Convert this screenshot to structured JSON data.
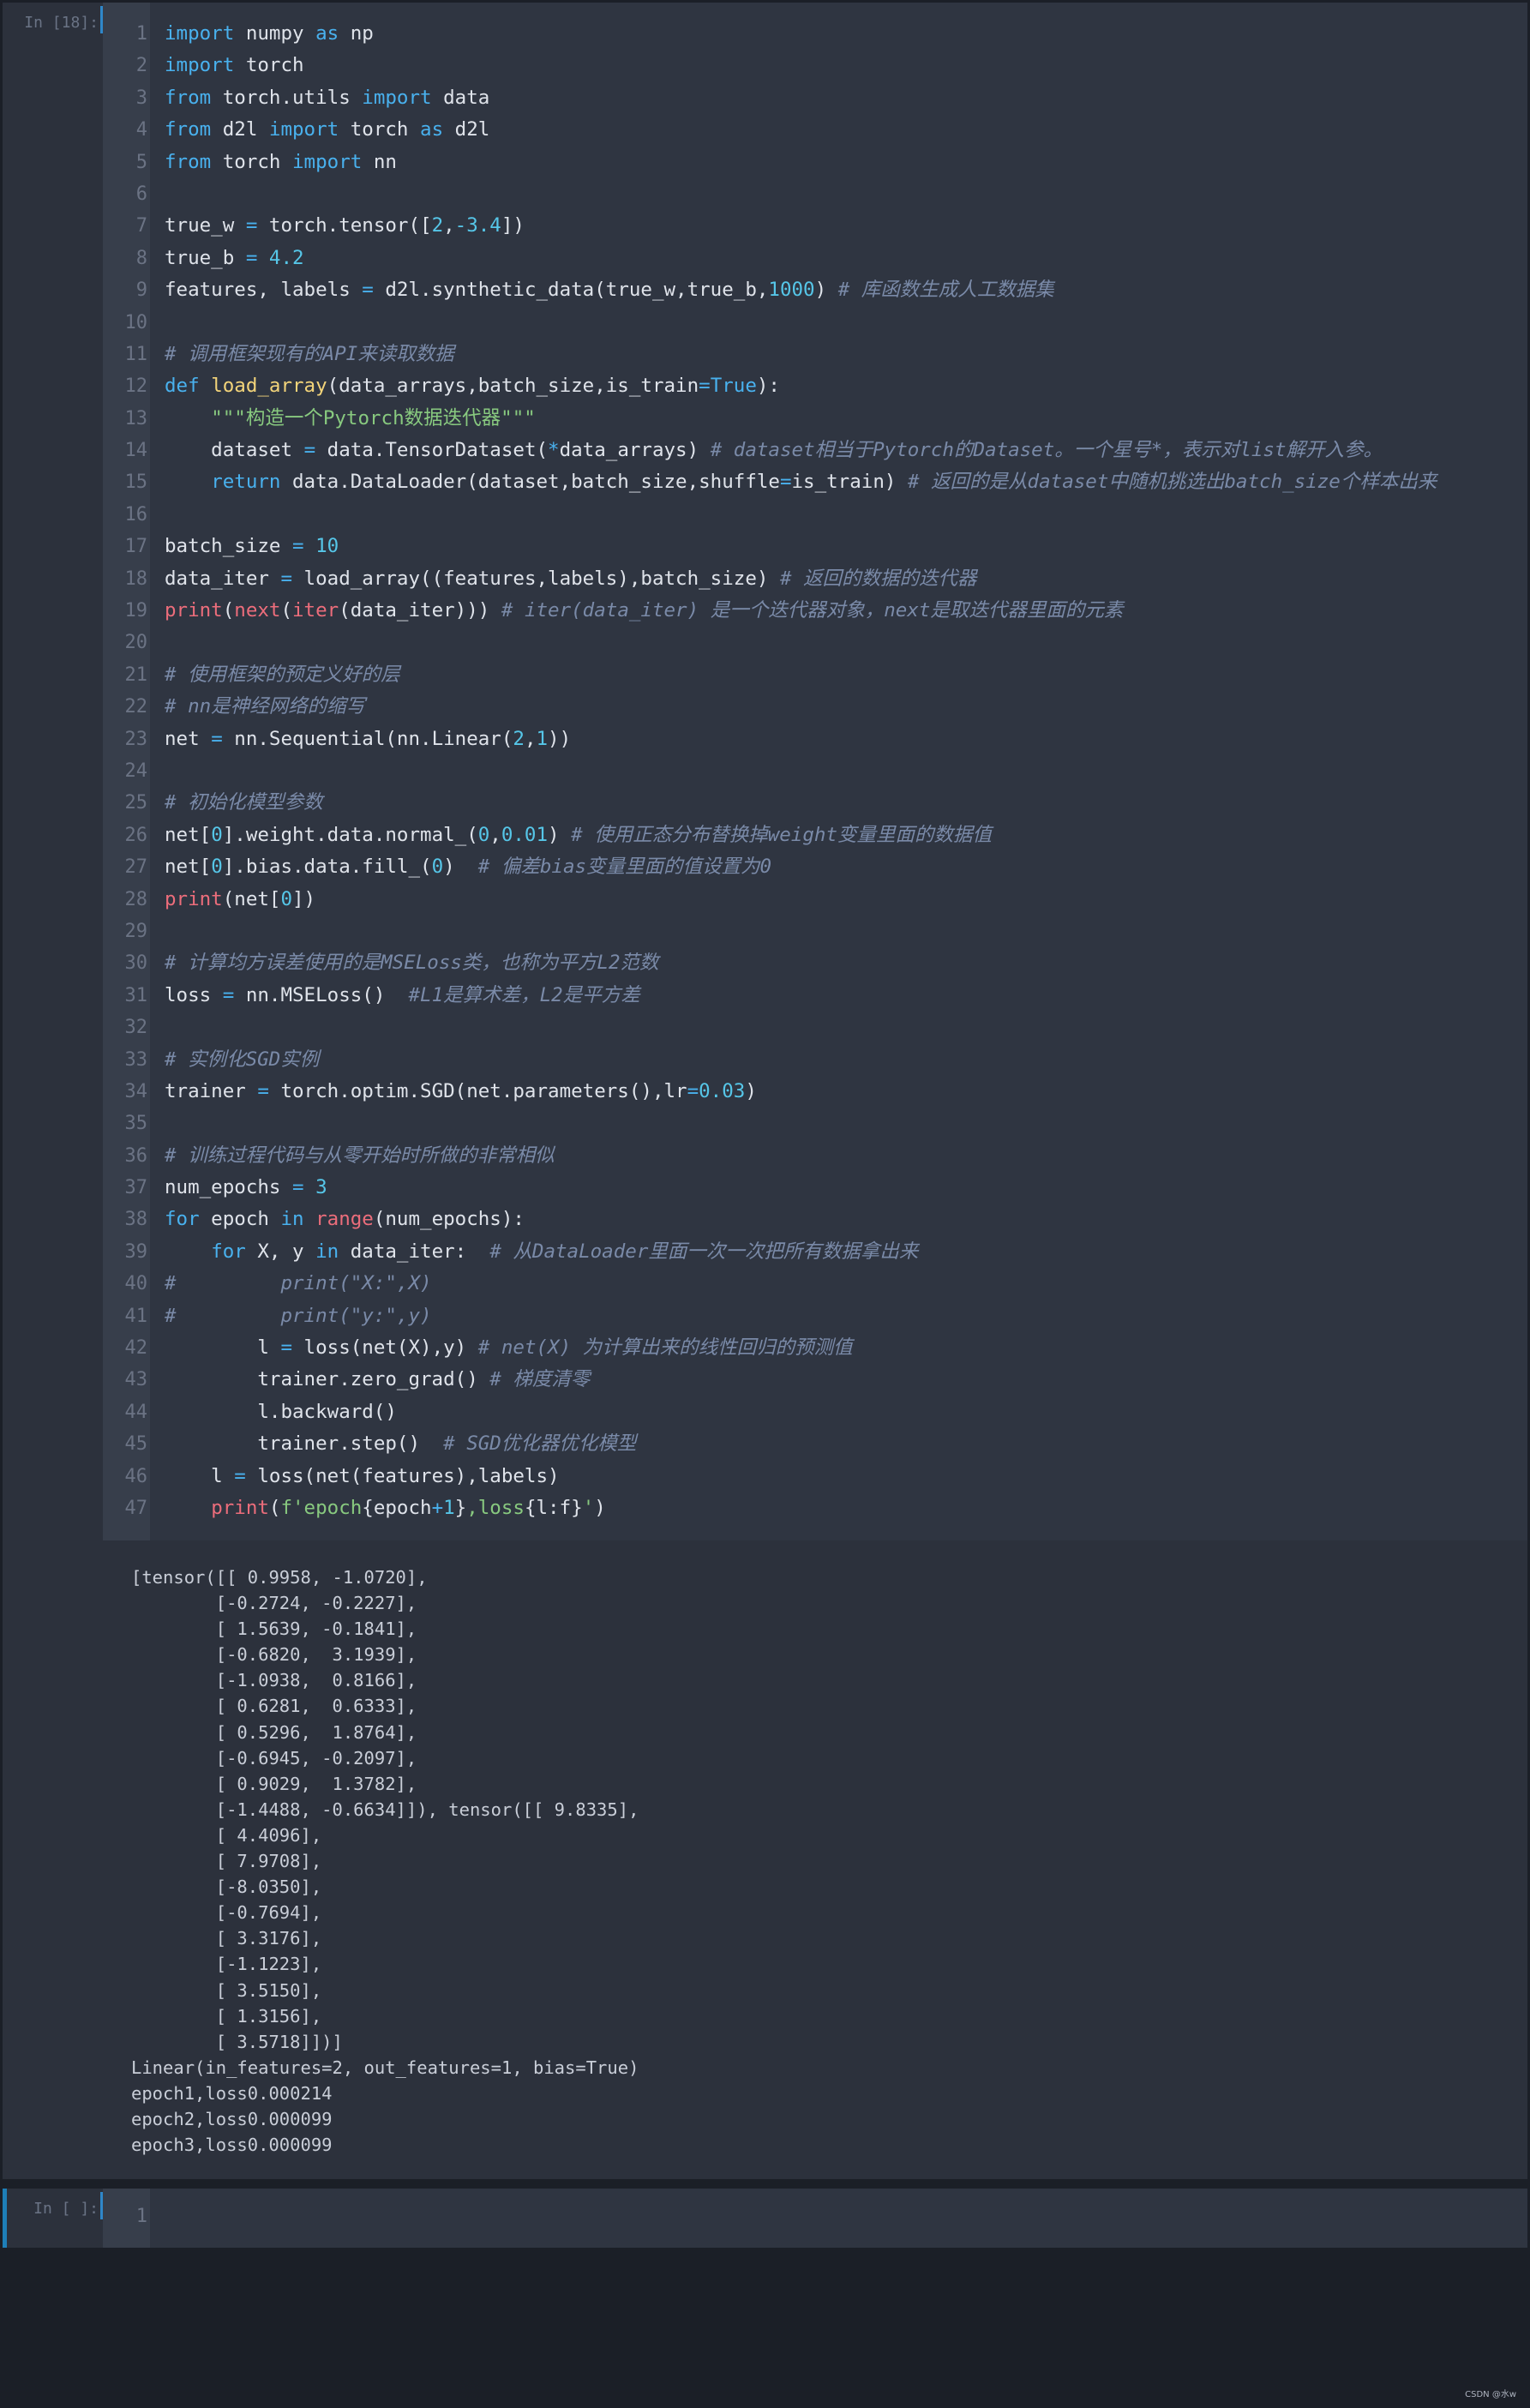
{
  "notebook": {
    "cells": [
      {
        "prompt": "In [18]:",
        "code_lines": [
          [
            [
              "kw",
              "import"
            ],
            [
              "txt",
              " numpy "
            ],
            [
              "kw",
              "as"
            ],
            [
              "txt",
              " np"
            ]
          ],
          [
            [
              "kw",
              "import"
            ],
            [
              "txt",
              " torch"
            ]
          ],
          [
            [
              "kw",
              "from"
            ],
            [
              "txt",
              " torch.utils "
            ],
            [
              "kw",
              "import"
            ],
            [
              "txt",
              " data"
            ]
          ],
          [
            [
              "kw",
              "from"
            ],
            [
              "txt",
              " d2l "
            ],
            [
              "kw",
              "import"
            ],
            [
              "txt",
              " torch "
            ],
            [
              "kw",
              "as"
            ],
            [
              "txt",
              " d2l"
            ]
          ],
          [
            [
              "kw",
              "from"
            ],
            [
              "txt",
              " torch "
            ],
            [
              "kw",
              "import"
            ],
            [
              "txt",
              " nn"
            ]
          ],
          [],
          [
            [
              "txt",
              "true_w "
            ],
            [
              "op",
              "="
            ],
            [
              "txt",
              " torch.tensor(["
            ],
            [
              "num",
              "2"
            ],
            [
              "txt",
              ","
            ],
            [
              "num",
              "-3.4"
            ],
            [
              "txt",
              "])"
            ]
          ],
          [
            [
              "txt",
              "true_b "
            ],
            [
              "op",
              "="
            ],
            [
              "txt",
              " "
            ],
            [
              "num",
              "4.2"
            ]
          ],
          [
            [
              "txt",
              "features, labels "
            ],
            [
              "op",
              "="
            ],
            [
              "txt",
              " d2l.synthetic_data(true_w,true_b,"
            ],
            [
              "num",
              "1000"
            ],
            [
              "txt",
              ") "
            ],
            [
              "com",
              "# 库函数生成人工数据集"
            ]
          ],
          [],
          [
            [
              "com",
              "# 调用框架现有的API来读取数据"
            ]
          ],
          [
            [
              "def",
              "def"
            ],
            [
              "txt",
              " "
            ],
            [
              "fn",
              "load_array"
            ],
            [
              "txt",
              "(data_arrays,batch_size,is_train"
            ],
            [
              "op",
              "="
            ],
            [
              "kw",
              "True"
            ],
            [
              "txt",
              "):"
            ]
          ],
          [
            [
              "txt",
              "    "
            ],
            [
              "str",
              "\"\"\"构造一个Pytorch数据迭代器\"\"\""
            ]
          ],
          [
            [
              "txt",
              "    dataset "
            ],
            [
              "op",
              "="
            ],
            [
              "txt",
              " data.TensorDataset("
            ],
            [
              "op",
              "*"
            ],
            [
              "txt",
              "data_arrays) "
            ],
            [
              "com",
              "# dataset相当于Pytorch的Dataset。一个星号*，表示对list解开入参。"
            ]
          ],
          [
            [
              "txt",
              "    "
            ],
            [
              "kw",
              "return"
            ],
            [
              "txt",
              " data.DataLoader(dataset,batch_size,shuffle"
            ],
            [
              "op",
              "="
            ],
            [
              "txt",
              "is_train) "
            ],
            [
              "com",
              "# 返回的是从dataset中随机挑选出batch_size个样本出来"
            ]
          ],
          [],
          [
            [
              "txt",
              "batch_size "
            ],
            [
              "op",
              "="
            ],
            [
              "txt",
              " "
            ],
            [
              "num",
              "10"
            ]
          ],
          [
            [
              "txt",
              "data_iter "
            ],
            [
              "op",
              "="
            ],
            [
              "txt",
              " load_array((features,labels),batch_size) "
            ],
            [
              "com",
              "# 返回的数据的迭代器"
            ]
          ],
          [
            [
              "bi",
              "print"
            ],
            [
              "txt",
              "("
            ],
            [
              "bi",
              "next"
            ],
            [
              "txt",
              "("
            ],
            [
              "bi",
              "iter"
            ],
            [
              "txt",
              "(data_iter))) "
            ],
            [
              "com",
              "# iter(data_iter) 是一个迭代器对象，next是取迭代器里面的元素"
            ]
          ],
          [],
          [
            [
              "com",
              "# 使用框架的预定义好的层"
            ]
          ],
          [
            [
              "com",
              "# nn是神经网络的缩写"
            ]
          ],
          [
            [
              "txt",
              "net "
            ],
            [
              "op",
              "="
            ],
            [
              "txt",
              " nn.Sequential(nn.Linear("
            ],
            [
              "num",
              "2"
            ],
            [
              "txt",
              ","
            ],
            [
              "num",
              "1"
            ],
            [
              "txt",
              "))"
            ]
          ],
          [],
          [
            [
              "com",
              "# 初始化模型参数"
            ]
          ],
          [
            [
              "txt",
              "net["
            ],
            [
              "num",
              "0"
            ],
            [
              "txt",
              "].weight.data.normal_("
            ],
            [
              "num",
              "0"
            ],
            [
              "txt",
              ","
            ],
            [
              "num",
              "0.01"
            ],
            [
              "txt",
              ") "
            ],
            [
              "com",
              "# 使用正态分布替换掉weight变量里面的数据值"
            ]
          ],
          [
            [
              "txt",
              "net["
            ],
            [
              "num",
              "0"
            ],
            [
              "txt",
              "].bias.data.fill_("
            ],
            [
              "num",
              "0"
            ],
            [
              "txt",
              ")  "
            ],
            [
              "com",
              "# 偏差bias变量里面的值设置为0"
            ]
          ],
          [
            [
              "bi",
              "print"
            ],
            [
              "txt",
              "(net["
            ],
            [
              "num",
              "0"
            ],
            [
              "txt",
              "])"
            ]
          ],
          [],
          [
            [
              "com",
              "# 计算均方误差使用的是MSELoss类，也称为平方L2范数"
            ]
          ],
          [
            [
              "txt",
              "loss "
            ],
            [
              "op",
              "="
            ],
            [
              "txt",
              " nn.MSELoss()  "
            ],
            [
              "com",
              "#L1是算术差，L2是平方差"
            ]
          ],
          [],
          [
            [
              "com",
              "# 实例化SGD实例"
            ]
          ],
          [
            [
              "txt",
              "trainer "
            ],
            [
              "op",
              "="
            ],
            [
              "txt",
              " torch.optim.SGD(net.parameters(),lr"
            ],
            [
              "op",
              "="
            ],
            [
              "num",
              "0.03"
            ],
            [
              "txt",
              ")"
            ]
          ],
          [],
          [
            [
              "com",
              "# 训练过程代码与从零开始时所做的非常相似"
            ]
          ],
          [
            [
              "txt",
              "num_epochs "
            ],
            [
              "op",
              "="
            ],
            [
              "txt",
              " "
            ],
            [
              "num",
              "3"
            ]
          ],
          [
            [
              "kw",
              "for"
            ],
            [
              "txt",
              " epoch "
            ],
            [
              "kw",
              "in"
            ],
            [
              "txt",
              " "
            ],
            [
              "bi",
              "range"
            ],
            [
              "txt",
              "(num_epochs):"
            ]
          ],
          [
            [
              "txt",
              "    "
            ],
            [
              "kw",
              "for"
            ],
            [
              "txt",
              " X, y "
            ],
            [
              "kw",
              "in"
            ],
            [
              "txt",
              " data_iter:  "
            ],
            [
              "com",
              "# 从DataLoader里面一次一次把所有数据拿出来"
            ]
          ],
          [
            [
              "com",
              "#         print(\"X:\",X)"
            ]
          ],
          [
            [
              "com",
              "#         print(\"y:\",y)"
            ]
          ],
          [
            [
              "txt",
              "        l "
            ],
            [
              "op",
              "="
            ],
            [
              "txt",
              " loss(net(X),y) "
            ],
            [
              "com",
              "# net(X) 为计算出来的线性回归的预测值"
            ]
          ],
          [
            [
              "txt",
              "        trainer.zero_grad() "
            ],
            [
              "com",
              "# 梯度清零"
            ]
          ],
          [
            [
              "txt",
              "        l.backward()"
            ]
          ],
          [
            [
              "txt",
              "        trainer.step()  "
            ],
            [
              "com",
              "# SGD优化器优化模型"
            ]
          ],
          [
            [
              "txt",
              "    l "
            ],
            [
              "op",
              "="
            ],
            [
              "txt",
              " loss(net(features),labels)"
            ]
          ],
          [
            [
              "txt",
              "    "
            ],
            [
              "bi",
              "print"
            ],
            [
              "txt",
              "("
            ],
            [
              "str",
              "f'epoch"
            ],
            [
              "txt",
              "{epoch"
            ],
            [
              "op",
              "+"
            ],
            [
              "num",
              "1"
            ],
            [
              "txt",
              "}"
            ],
            [
              "str",
              ",loss"
            ],
            [
              "txt",
              "{l:f}"
            ],
            [
              "str",
              "'"
            ],
            [
              "txt",
              ")"
            ]
          ]
        ],
        "output": "[tensor([[ 0.9958, -1.0720],\n        [-0.2724, -0.2227],\n        [ 1.5639, -0.1841],\n        [-0.6820,  3.1939],\n        [-1.0938,  0.8166],\n        [ 0.6281,  0.6333],\n        [ 0.5296,  1.8764],\n        [-0.6945, -0.2097],\n        [ 0.9029,  1.3782],\n        [-1.4488, -0.6634]]), tensor([[ 9.8335],\n        [ 4.4096],\n        [ 7.9708],\n        [-8.0350],\n        [-0.7694],\n        [ 3.3176],\n        [-1.1223],\n        [ 3.5150],\n        [ 1.3156],\n        [ 3.5718]])]\nLinear(in_features=2, out_features=1, bias=True)\nepoch1,loss0.000214\nepoch2,loss0.000099\nepoch3,loss0.000099"
      },
      {
        "prompt": "In [ ]:",
        "code_lines": [
          []
        ]
      }
    ]
  },
  "watermark": "CSDN @水w"
}
